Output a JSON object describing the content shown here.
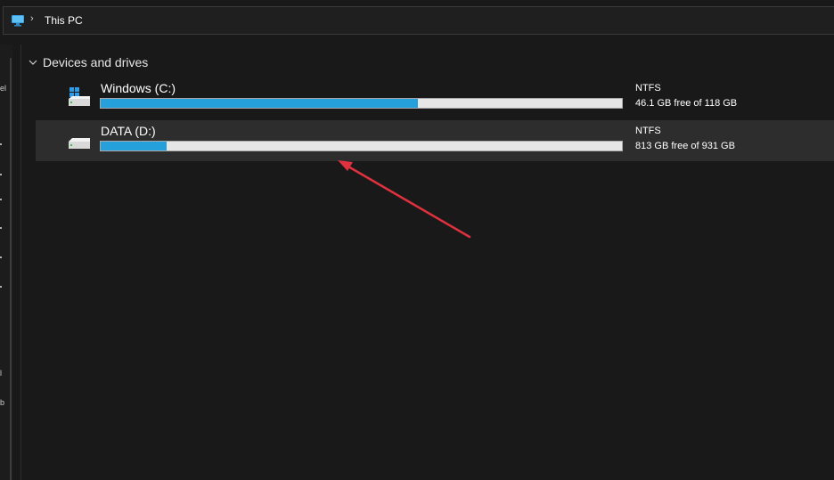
{
  "address": {
    "icon": "this-pc-icon",
    "separator": "›",
    "location": "This PC"
  },
  "nav_fragments": [
    "el",
    "l",
    "b"
  ],
  "group": {
    "title": "Devices and drives",
    "chevron_icon": "chevron-down-icon"
  },
  "drives": [
    {
      "name": "Windows (C:)",
      "icon": "windows-drive-icon",
      "filesystem": "NTFS",
      "free_text": "46.1 GB free of 118 GB",
      "used_fraction": 0.609,
      "selected": false
    },
    {
      "name": "DATA (D:)",
      "icon": "hard-drive-icon",
      "filesystem": "NTFS",
      "free_text": "813 GB free of 931 GB",
      "used_fraction": 0.127,
      "selected": true
    }
  ],
  "colors": {
    "bar_fill": "#26a0da",
    "bar_track": "#e6e6e6",
    "annotation_arrow": "#e0313f"
  }
}
